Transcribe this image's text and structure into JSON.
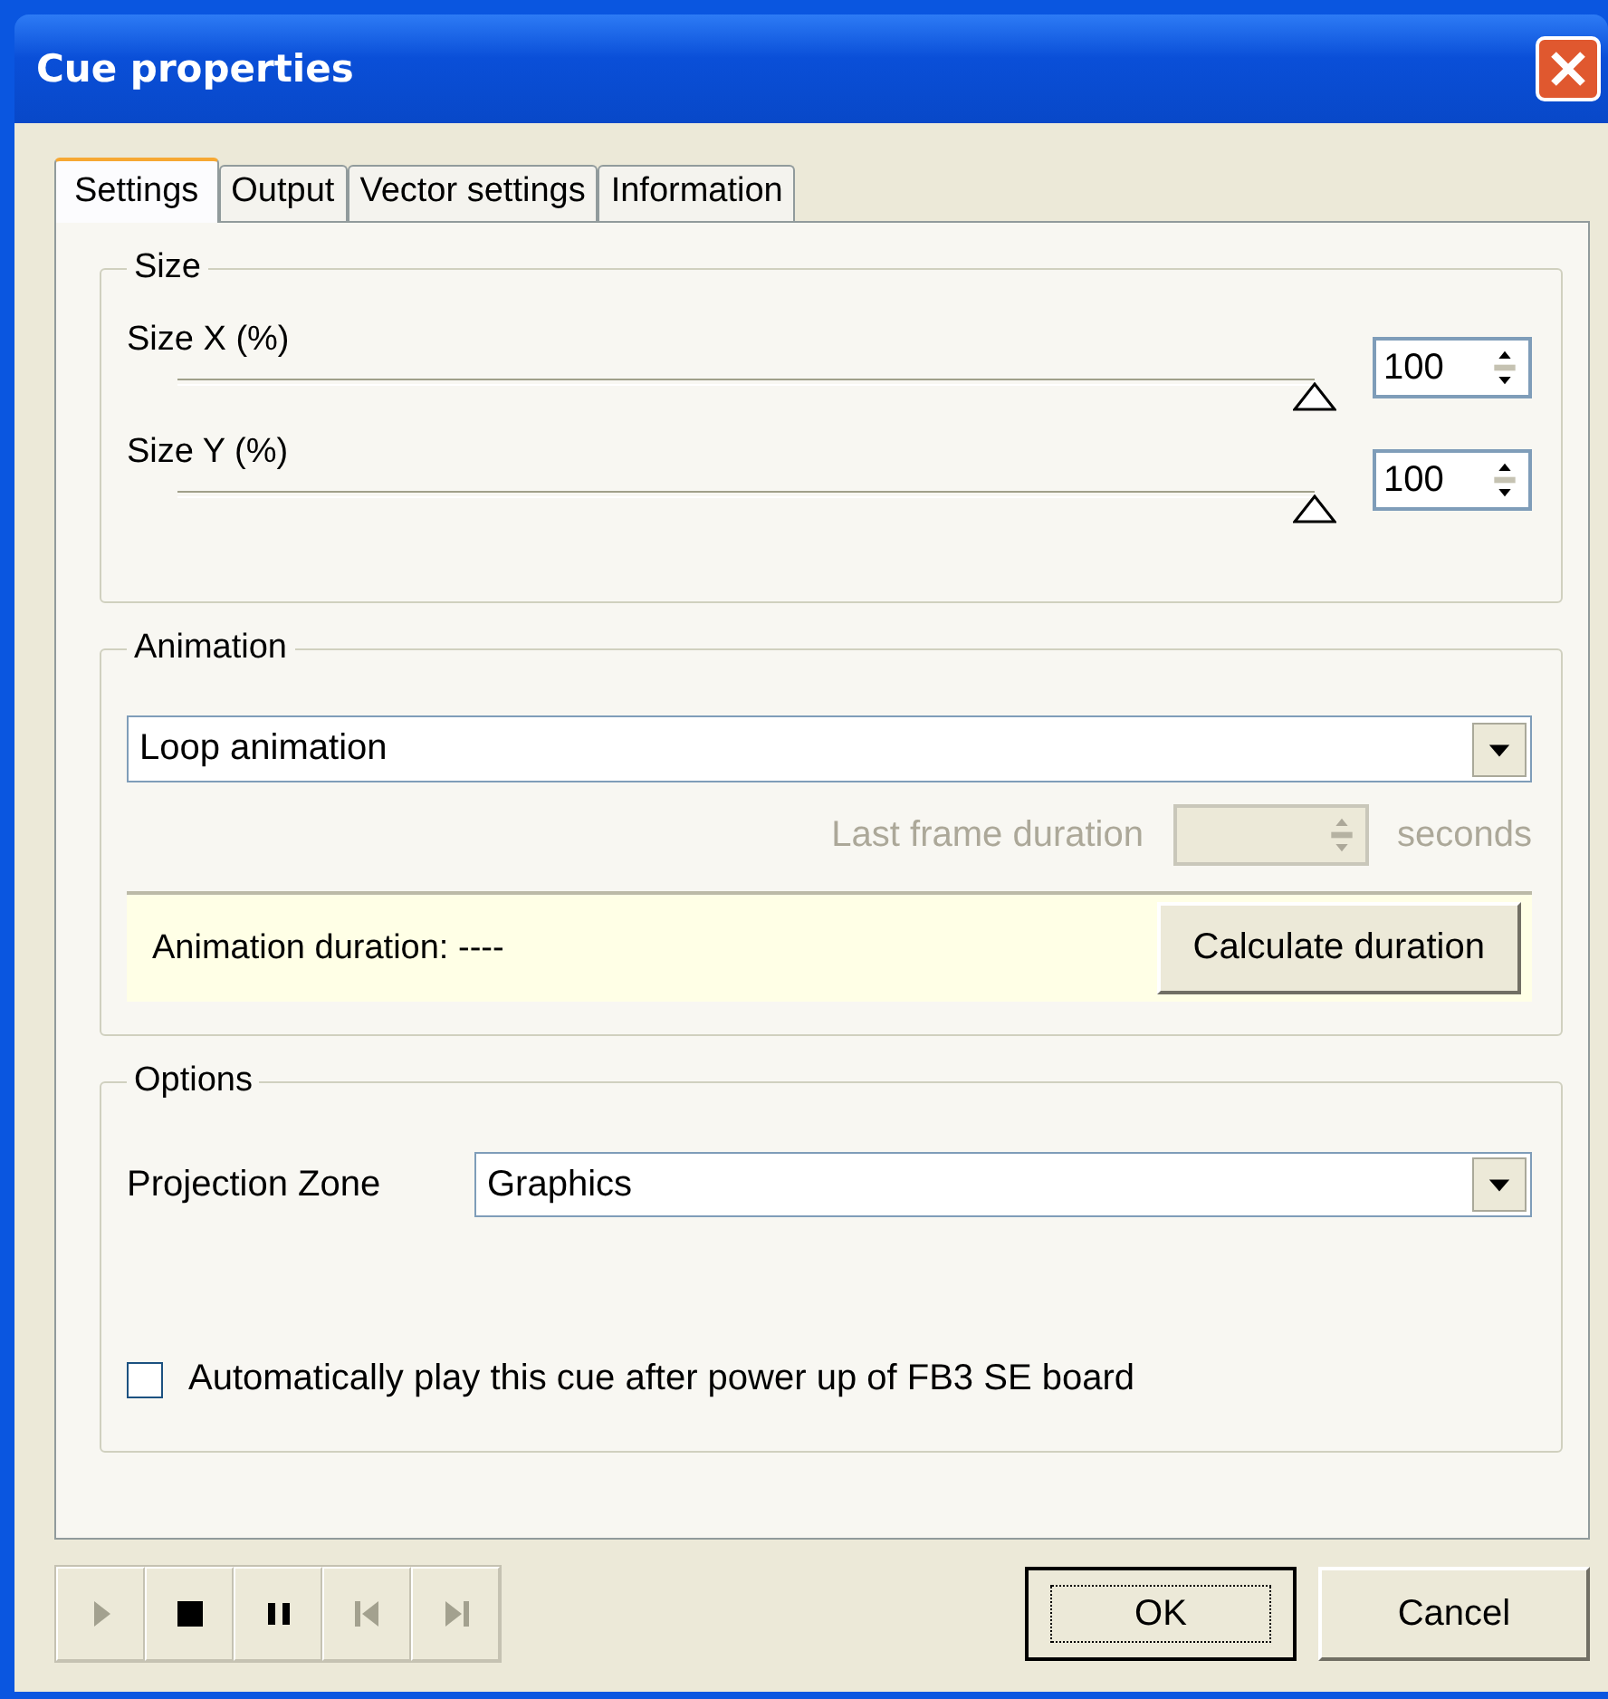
{
  "window": {
    "title": "Cue properties"
  },
  "tabs": [
    {
      "label": "Settings",
      "selected": true
    },
    {
      "label": "Output",
      "selected": false
    },
    {
      "label": "Vector settings",
      "selected": false
    },
    {
      "label": "Information",
      "selected": false
    }
  ],
  "size": {
    "title": "Size",
    "sliders": [
      {
        "label": "Size X (%)",
        "level": 1.0,
        "value": "100"
      },
      {
        "label": "Size Y (%)",
        "level": 1.0,
        "value": "100"
      }
    ]
  },
  "animation": {
    "title": "Animation",
    "mode": "Loop animation",
    "last_frame": {
      "label": "Last frame duration",
      "unit": "seconds",
      "disabled": true
    },
    "duration_label": "Animation duration: ----",
    "calculate_button": "Calculate duration"
  },
  "options": {
    "title": "Options",
    "zone_label": "Projection Zone",
    "zone": "Graphics",
    "autoplay": {
      "label": "Automatically play this cue after power up of FB3 SE board",
      "checked": false
    }
  },
  "media_buttons": [
    {
      "kind": "play",
      "disabled": true
    },
    {
      "kind": "stop",
      "disabled": false
    },
    {
      "kind": "pause",
      "disabled": false
    },
    {
      "kind": "prev",
      "disabled": true
    },
    {
      "kind": "next",
      "disabled": true
    }
  ],
  "buttons": [
    {
      "label": "OK",
      "default": true
    },
    {
      "label": "Cancel",
      "default": false
    }
  ]
}
